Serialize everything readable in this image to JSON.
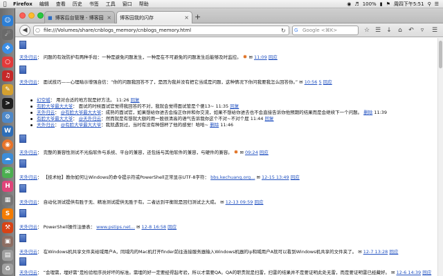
{
  "menubar": {
    "items": [
      "Firefox",
      "编辑",
      "查看",
      "历史",
      "书签",
      "工具",
      "窗口",
      "帮助"
    ],
    "battery": "100%",
    "clock": "周四下午5:51"
  },
  "tabs": [
    {
      "label": "博客后台管理 - 博客园"
    },
    {
      "label": "博客园我的闪存"
    }
  ],
  "url": "file:///Volumes/share/cnblogs_memory/cnblogs_memory.html",
  "search_placeholder": "Google <⌘K>",
  "entries": [
    {
      "author": "天外归云",
      "text": "问题的有效防护有两种手段：一种是避免问题发生，一种是在不可避免的问题发生后能够及时监控。",
      "time": "11:09",
      "reply": "回应"
    },
    {
      "author": "天外归云",
      "text": "面试技巧——心理暗示增强自信：“你的问题我回答不了，是因为我并没有把它当成是问题，这种情况下你问我要我怎么回答你。”",
      "time": "10:56",
      "count": "5",
      "reply": "回应"
    },
    {
      "author": "天外归云",
      "text": "完整的兼容性测试不光指软件与系统、平台的兼容，还包括与其他软件的兼容，与硬件的兼容。",
      "time": "09:24",
      "reply": "回应"
    },
    {
      "author": "天外归云",
      "text": "【技术帖】教你如何让Windows的命令提示符或PowerShell正常显示UTF-8字符：",
      "link": "bbs.kechuang.org...",
      "time": "12-15 13:49",
      "reply": "回应"
    },
    {
      "author": "天外归云",
      "text": "自动化测试提供有胜于无、精准测试提供无胜于有。二者达到平衡就是回归测试之大成。",
      "time": "12-13 09:59",
      "reply": "回应"
    },
    {
      "author": "天外归云",
      "text": "PowerShell操作注册表：",
      "link": "www.pstips.net...",
      "time": "12-8 16:58",
      "reply": "回应"
    },
    {
      "author": "天外归云",
      "text": "在Windows机共享文件夹给域用户A，同域内的Mac机打开finder前往连接服务器输入Windows机器的ip和域用户A就可以看到Windows机共享的文件夹了。",
      "time": "12-7 13:28",
      "reply": "回应"
    },
    {
      "author": "天外归云",
      "text": "“会理需，埋好需”是检验程序员好坏的标准。需埋的好一定要经得起考验，所以才需要QA。QA的职责就是扫雷，扫雷的结果并不是要证明此处无雷，而是要证明雷已经藏好。",
      "time": "12-6 14:39",
      "reply": "回应"
    }
  ],
  "replies": [
    {
      "author": "幻空城",
      "text": "用对合适的地方就是好方法。",
      "time": "11:26",
      "reply": "回复"
    },
    {
      "author": "有脸大爷最大大爷",
      "text": "面试的时候面试官觉得我回答的不对，我就会觉得面试管是个傻13~",
      "time": "11:35",
      "reply": "回复"
    },
    {
      "author": "天外归云",
      "mention": "@有脸大爷最大大爷",
      "text": "：成熟的面试官，如果想给你进去会指正你并和你交流，如果不想给你进去也不会直接告诉你他预期的结果而是会继续下一个问题。",
      "delete": "删除",
      "time": "11:39"
    },
    {
      "author": "有脸大爷最大大爷",
      "mention": "@天外归云",
      "text": "：然而就是有想就大额的用一股很清高的语气告诉我你这个不对~不对个屁",
      "time": "11:44",
      "reply": "回复"
    },
    {
      "author": "天外归云",
      "mention": "@有脸大爷最大大爷",
      "text": "：我就遇到过，当时有没有种想杯了他的感觉！哈哈~",
      "delete": "删除",
      "time": "11:46"
    }
  ]
}
